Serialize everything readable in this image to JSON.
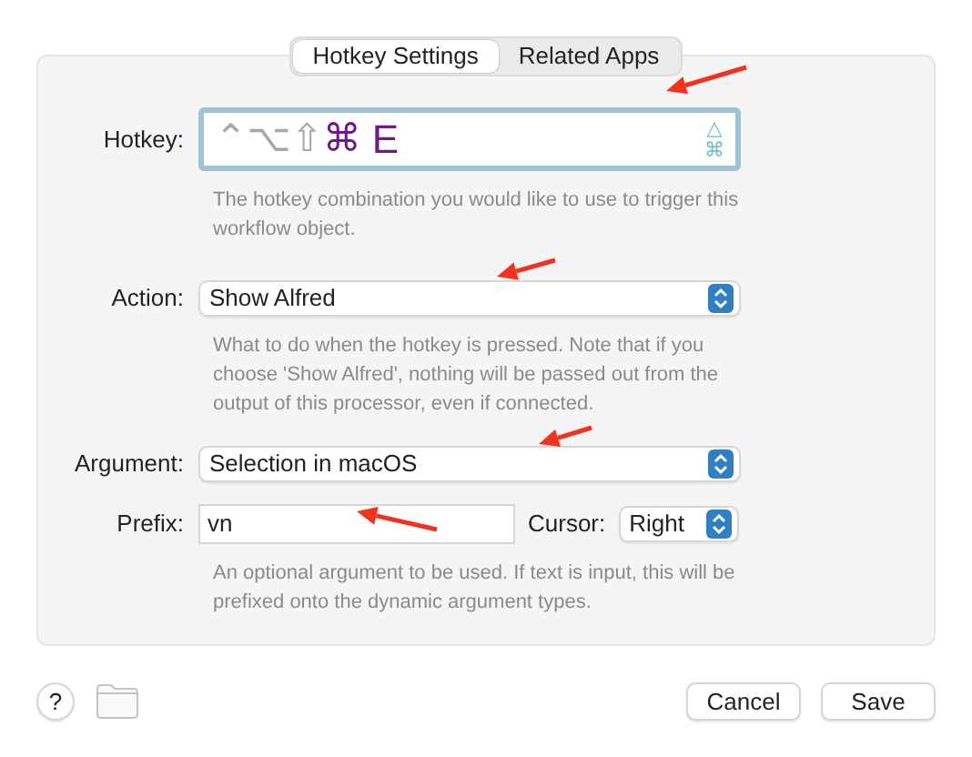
{
  "tabs": [
    {
      "label": "Hotkey Settings",
      "selected": true
    },
    {
      "label": "Related Apps",
      "selected": false
    }
  ],
  "hotkey": {
    "label": "Hotkey:",
    "modifiers": [
      {
        "symbol": "⌃",
        "active": false
      },
      {
        "symbol": "⌥",
        "active": false
      },
      {
        "symbol": "⇧",
        "active": false
      },
      {
        "symbol": "⌘",
        "active": true
      }
    ],
    "key": "E",
    "side_symbols": [
      "△",
      "⌘"
    ],
    "help": "The hotkey combination you would like to use to trigger this workflow object."
  },
  "action": {
    "label": "Action:",
    "value": "Show Alfred",
    "help": "What to do when the hotkey is pressed. Note that if you choose 'Show Alfred', nothing will be passed out from the output of this processor, even if connected."
  },
  "argument": {
    "label": "Argument:",
    "value": "Selection in macOS"
  },
  "prefix": {
    "label": "Prefix:",
    "value": "vn",
    "cursor_label": "Cursor:",
    "cursor_value": "Right",
    "help": "An optional argument to be used. If text is input, this will be prefixed onto the dynamic argument types."
  },
  "footer": {
    "help_button": "?",
    "buttons": [
      "Cancel",
      "Save"
    ]
  }
}
